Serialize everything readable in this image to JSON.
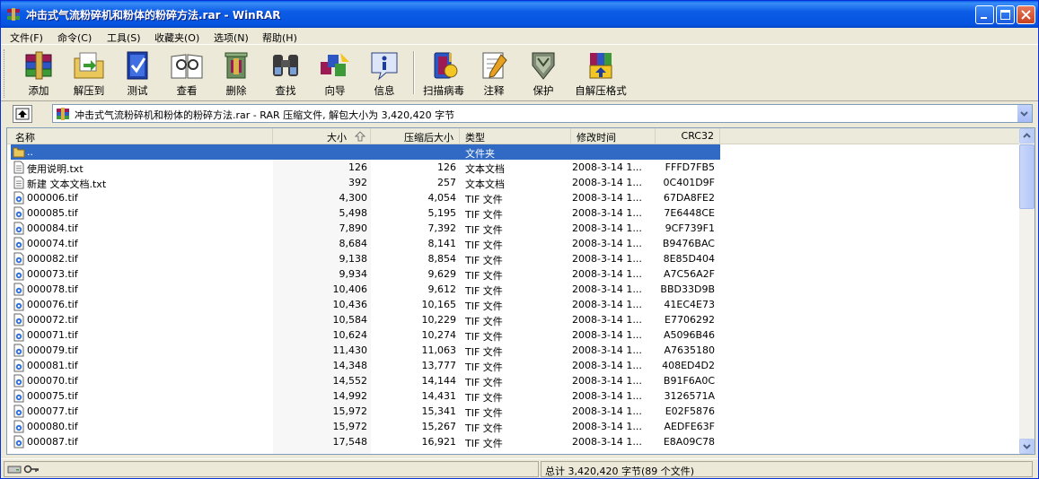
{
  "window": {
    "title": "冲击式气流粉碎机和粉体的粉碎方法.rar - WinRAR",
    "minimize_icon": "minimize-icon",
    "maximize_icon": "maximize-icon",
    "close_icon": "close-icon"
  },
  "menu": [
    {
      "label": "文件(F)"
    },
    {
      "label": "命令(C)"
    },
    {
      "label": "工具(S)"
    },
    {
      "label": "收藏夹(O)"
    },
    {
      "label": "选项(N)"
    },
    {
      "label": "帮助(H)"
    }
  ],
  "toolbar": [
    {
      "label": "添加",
      "icon": "books-add-icon"
    },
    {
      "label": "解压到",
      "icon": "extract-folder-icon"
    },
    {
      "label": "测试",
      "icon": "test-book-icon"
    },
    {
      "label": "查看",
      "icon": "view-book-icon"
    },
    {
      "label": "删除",
      "icon": "delete-icon"
    },
    {
      "label": "查找",
      "icon": "binoculars-icon"
    },
    {
      "label": "向导",
      "icon": "wizard-icon"
    },
    {
      "label": "信息",
      "icon": "info-icon"
    },
    {
      "label": "扫描病毒",
      "icon": "virus-scan-icon"
    },
    {
      "label": "注释",
      "icon": "comment-icon"
    },
    {
      "label": "保护",
      "icon": "shield-icon"
    },
    {
      "label": "自解压格式",
      "icon": "sfx-icon"
    }
  ],
  "address": {
    "text": "冲击式气流粉碎机和粉体的粉碎方法.rar - RAR 压缩文件, 解包大小为 3,420,420 字节"
  },
  "columns": {
    "name": "名称",
    "size": "大小",
    "packed": "压缩后大小",
    "type": "类型",
    "modified": "修改时间",
    "crc": "CRC32"
  },
  "rows": [
    {
      "name": "..",
      "size": "",
      "packed": "",
      "type": "文件夹",
      "modified": "",
      "crc": "",
      "kind": "folder"
    },
    {
      "name": "使用说明.txt",
      "size": "126",
      "packed": "126",
      "type": "文本文档",
      "modified": "2008-3-14 1...",
      "crc": "FFFD7FB5",
      "kind": "txt"
    },
    {
      "name": "新建 文本文档.txt",
      "size": "392",
      "packed": "257",
      "type": "文本文档",
      "modified": "2008-3-14 1...",
      "crc": "0C401D9F",
      "kind": "txt"
    },
    {
      "name": "000006.tif",
      "size": "4,300",
      "packed": "4,054",
      "type": "TIF 文件",
      "modified": "2008-3-14 1...",
      "crc": "67DA8FE2",
      "kind": "tif"
    },
    {
      "name": "000085.tif",
      "size": "5,498",
      "packed": "5,195",
      "type": "TIF 文件",
      "modified": "2008-3-14 1...",
      "crc": "7E6448CE",
      "kind": "tif"
    },
    {
      "name": "000084.tif",
      "size": "7,890",
      "packed": "7,392",
      "type": "TIF 文件",
      "modified": "2008-3-14 1...",
      "crc": "9CF739F1",
      "kind": "tif"
    },
    {
      "name": "000074.tif",
      "size": "8,684",
      "packed": "8,141",
      "type": "TIF 文件",
      "modified": "2008-3-14 1...",
      "crc": "B9476BAC",
      "kind": "tif"
    },
    {
      "name": "000082.tif",
      "size": "9,138",
      "packed": "8,854",
      "type": "TIF 文件",
      "modified": "2008-3-14 1...",
      "crc": "8E85D404",
      "kind": "tif"
    },
    {
      "name": "000073.tif",
      "size": "9,934",
      "packed": "9,629",
      "type": "TIF 文件",
      "modified": "2008-3-14 1...",
      "crc": "A7C56A2F",
      "kind": "tif"
    },
    {
      "name": "000078.tif",
      "size": "10,406",
      "packed": "9,612",
      "type": "TIF 文件",
      "modified": "2008-3-14 1...",
      "crc": "BBD33D9B",
      "kind": "tif"
    },
    {
      "name": "000076.tif",
      "size": "10,436",
      "packed": "10,165",
      "type": "TIF 文件",
      "modified": "2008-3-14 1...",
      "crc": "41EC4E73",
      "kind": "tif"
    },
    {
      "name": "000072.tif",
      "size": "10,584",
      "packed": "10,229",
      "type": "TIF 文件",
      "modified": "2008-3-14 1...",
      "crc": "E7706292",
      "kind": "tif"
    },
    {
      "name": "000071.tif",
      "size": "10,624",
      "packed": "10,274",
      "type": "TIF 文件",
      "modified": "2008-3-14 1...",
      "crc": "A5096B46",
      "kind": "tif"
    },
    {
      "name": "000079.tif",
      "size": "11,430",
      "packed": "11,063",
      "type": "TIF 文件",
      "modified": "2008-3-14 1...",
      "crc": "A7635180",
      "kind": "tif"
    },
    {
      "name": "000081.tif",
      "size": "14,348",
      "packed": "13,777",
      "type": "TIF 文件",
      "modified": "2008-3-14 1...",
      "crc": "408ED4D2",
      "kind": "tif"
    },
    {
      "name": "000070.tif",
      "size": "14,552",
      "packed": "14,144",
      "type": "TIF 文件",
      "modified": "2008-3-14 1...",
      "crc": "B91F6A0C",
      "kind": "tif"
    },
    {
      "name": "000075.tif",
      "size": "14,992",
      "packed": "14,431",
      "type": "TIF 文件",
      "modified": "2008-3-14 1...",
      "crc": "3126571A",
      "kind": "tif"
    },
    {
      "name": "000077.tif",
      "size": "15,972",
      "packed": "15,341",
      "type": "TIF 文件",
      "modified": "2008-3-14 1...",
      "crc": "E02F5876",
      "kind": "tif"
    },
    {
      "name": "000080.tif",
      "size": "15,972",
      "packed": "15,267",
      "type": "TIF 文件",
      "modified": "2008-3-14 1...",
      "crc": "AEDFE63F",
      "kind": "tif"
    },
    {
      "name": "000087.tif",
      "size": "17,548",
      "packed": "16,921",
      "type": "TIF 文件",
      "modified": "2008-3-14 1...",
      "crc": "E8A09C78",
      "kind": "tif"
    }
  ],
  "status": {
    "right": "总计 3,420,420 字节(89 个文件)",
    "left_icons": [
      "drive-icon",
      "key-icon"
    ]
  },
  "colors": {
    "title_bar": "#0554E0",
    "selection": "#316AC5",
    "face": "#ECE9D8"
  }
}
